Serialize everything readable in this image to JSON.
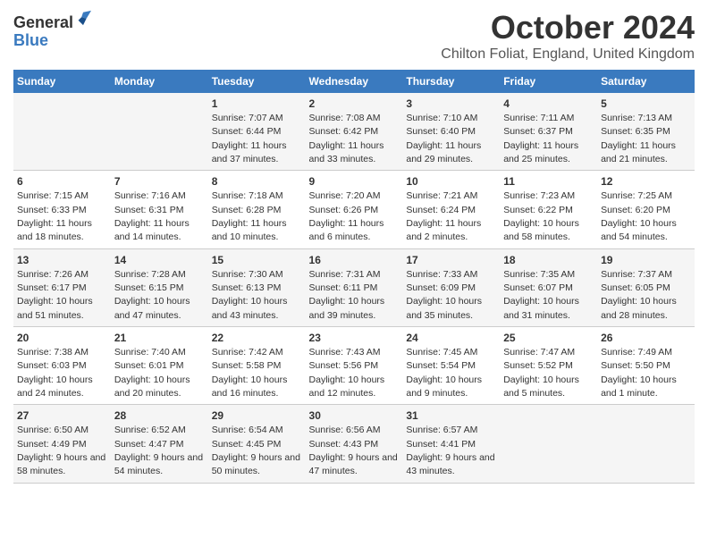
{
  "logo": {
    "general": "General",
    "blue": "Blue"
  },
  "header": {
    "month": "October 2024",
    "location": "Chilton Foliat, England, United Kingdom"
  },
  "weekdays": [
    "Sunday",
    "Monday",
    "Tuesday",
    "Wednesday",
    "Thursday",
    "Friday",
    "Saturday"
  ],
  "weeks": [
    [
      {
        "day": "",
        "sunrise": "",
        "sunset": "",
        "daylight": ""
      },
      {
        "day": "",
        "sunrise": "",
        "sunset": "",
        "daylight": ""
      },
      {
        "day": "1",
        "sunrise": "Sunrise: 7:07 AM",
        "sunset": "Sunset: 6:44 PM",
        "daylight": "Daylight: 11 hours and 37 minutes."
      },
      {
        "day": "2",
        "sunrise": "Sunrise: 7:08 AM",
        "sunset": "Sunset: 6:42 PM",
        "daylight": "Daylight: 11 hours and 33 minutes."
      },
      {
        "day": "3",
        "sunrise": "Sunrise: 7:10 AM",
        "sunset": "Sunset: 6:40 PM",
        "daylight": "Daylight: 11 hours and 29 minutes."
      },
      {
        "day": "4",
        "sunrise": "Sunrise: 7:11 AM",
        "sunset": "Sunset: 6:37 PM",
        "daylight": "Daylight: 11 hours and 25 minutes."
      },
      {
        "day": "5",
        "sunrise": "Sunrise: 7:13 AM",
        "sunset": "Sunset: 6:35 PM",
        "daylight": "Daylight: 11 hours and 21 minutes."
      }
    ],
    [
      {
        "day": "6",
        "sunrise": "Sunrise: 7:15 AM",
        "sunset": "Sunset: 6:33 PM",
        "daylight": "Daylight: 11 hours and 18 minutes."
      },
      {
        "day": "7",
        "sunrise": "Sunrise: 7:16 AM",
        "sunset": "Sunset: 6:31 PM",
        "daylight": "Daylight: 11 hours and 14 minutes."
      },
      {
        "day": "8",
        "sunrise": "Sunrise: 7:18 AM",
        "sunset": "Sunset: 6:28 PM",
        "daylight": "Daylight: 11 hours and 10 minutes."
      },
      {
        "day": "9",
        "sunrise": "Sunrise: 7:20 AM",
        "sunset": "Sunset: 6:26 PM",
        "daylight": "Daylight: 11 hours and 6 minutes."
      },
      {
        "day": "10",
        "sunrise": "Sunrise: 7:21 AM",
        "sunset": "Sunset: 6:24 PM",
        "daylight": "Daylight: 11 hours and 2 minutes."
      },
      {
        "day": "11",
        "sunrise": "Sunrise: 7:23 AM",
        "sunset": "Sunset: 6:22 PM",
        "daylight": "Daylight: 10 hours and 58 minutes."
      },
      {
        "day": "12",
        "sunrise": "Sunrise: 7:25 AM",
        "sunset": "Sunset: 6:20 PM",
        "daylight": "Daylight: 10 hours and 54 minutes."
      }
    ],
    [
      {
        "day": "13",
        "sunrise": "Sunrise: 7:26 AM",
        "sunset": "Sunset: 6:17 PM",
        "daylight": "Daylight: 10 hours and 51 minutes."
      },
      {
        "day": "14",
        "sunrise": "Sunrise: 7:28 AM",
        "sunset": "Sunset: 6:15 PM",
        "daylight": "Daylight: 10 hours and 47 minutes."
      },
      {
        "day": "15",
        "sunrise": "Sunrise: 7:30 AM",
        "sunset": "Sunset: 6:13 PM",
        "daylight": "Daylight: 10 hours and 43 minutes."
      },
      {
        "day": "16",
        "sunrise": "Sunrise: 7:31 AM",
        "sunset": "Sunset: 6:11 PM",
        "daylight": "Daylight: 10 hours and 39 minutes."
      },
      {
        "day": "17",
        "sunrise": "Sunrise: 7:33 AM",
        "sunset": "Sunset: 6:09 PM",
        "daylight": "Daylight: 10 hours and 35 minutes."
      },
      {
        "day": "18",
        "sunrise": "Sunrise: 7:35 AM",
        "sunset": "Sunset: 6:07 PM",
        "daylight": "Daylight: 10 hours and 31 minutes."
      },
      {
        "day": "19",
        "sunrise": "Sunrise: 7:37 AM",
        "sunset": "Sunset: 6:05 PM",
        "daylight": "Daylight: 10 hours and 28 minutes."
      }
    ],
    [
      {
        "day": "20",
        "sunrise": "Sunrise: 7:38 AM",
        "sunset": "Sunset: 6:03 PM",
        "daylight": "Daylight: 10 hours and 24 minutes."
      },
      {
        "day": "21",
        "sunrise": "Sunrise: 7:40 AM",
        "sunset": "Sunset: 6:01 PM",
        "daylight": "Daylight: 10 hours and 20 minutes."
      },
      {
        "day": "22",
        "sunrise": "Sunrise: 7:42 AM",
        "sunset": "Sunset: 5:58 PM",
        "daylight": "Daylight: 10 hours and 16 minutes."
      },
      {
        "day": "23",
        "sunrise": "Sunrise: 7:43 AM",
        "sunset": "Sunset: 5:56 PM",
        "daylight": "Daylight: 10 hours and 12 minutes."
      },
      {
        "day": "24",
        "sunrise": "Sunrise: 7:45 AM",
        "sunset": "Sunset: 5:54 PM",
        "daylight": "Daylight: 10 hours and 9 minutes."
      },
      {
        "day": "25",
        "sunrise": "Sunrise: 7:47 AM",
        "sunset": "Sunset: 5:52 PM",
        "daylight": "Daylight: 10 hours and 5 minutes."
      },
      {
        "day": "26",
        "sunrise": "Sunrise: 7:49 AM",
        "sunset": "Sunset: 5:50 PM",
        "daylight": "Daylight: 10 hours and 1 minute."
      }
    ],
    [
      {
        "day": "27",
        "sunrise": "Sunrise: 6:50 AM",
        "sunset": "Sunset: 4:49 PM",
        "daylight": "Daylight: 9 hours and 58 minutes."
      },
      {
        "day": "28",
        "sunrise": "Sunrise: 6:52 AM",
        "sunset": "Sunset: 4:47 PM",
        "daylight": "Daylight: 9 hours and 54 minutes."
      },
      {
        "day": "29",
        "sunrise": "Sunrise: 6:54 AM",
        "sunset": "Sunset: 4:45 PM",
        "daylight": "Daylight: 9 hours and 50 minutes."
      },
      {
        "day": "30",
        "sunrise": "Sunrise: 6:56 AM",
        "sunset": "Sunset: 4:43 PM",
        "daylight": "Daylight: 9 hours and 47 minutes."
      },
      {
        "day": "31",
        "sunrise": "Sunrise: 6:57 AM",
        "sunset": "Sunset: 4:41 PM",
        "daylight": "Daylight: 9 hours and 43 minutes."
      },
      {
        "day": "",
        "sunrise": "",
        "sunset": "",
        "daylight": ""
      },
      {
        "day": "",
        "sunrise": "",
        "sunset": "",
        "daylight": ""
      }
    ]
  ]
}
